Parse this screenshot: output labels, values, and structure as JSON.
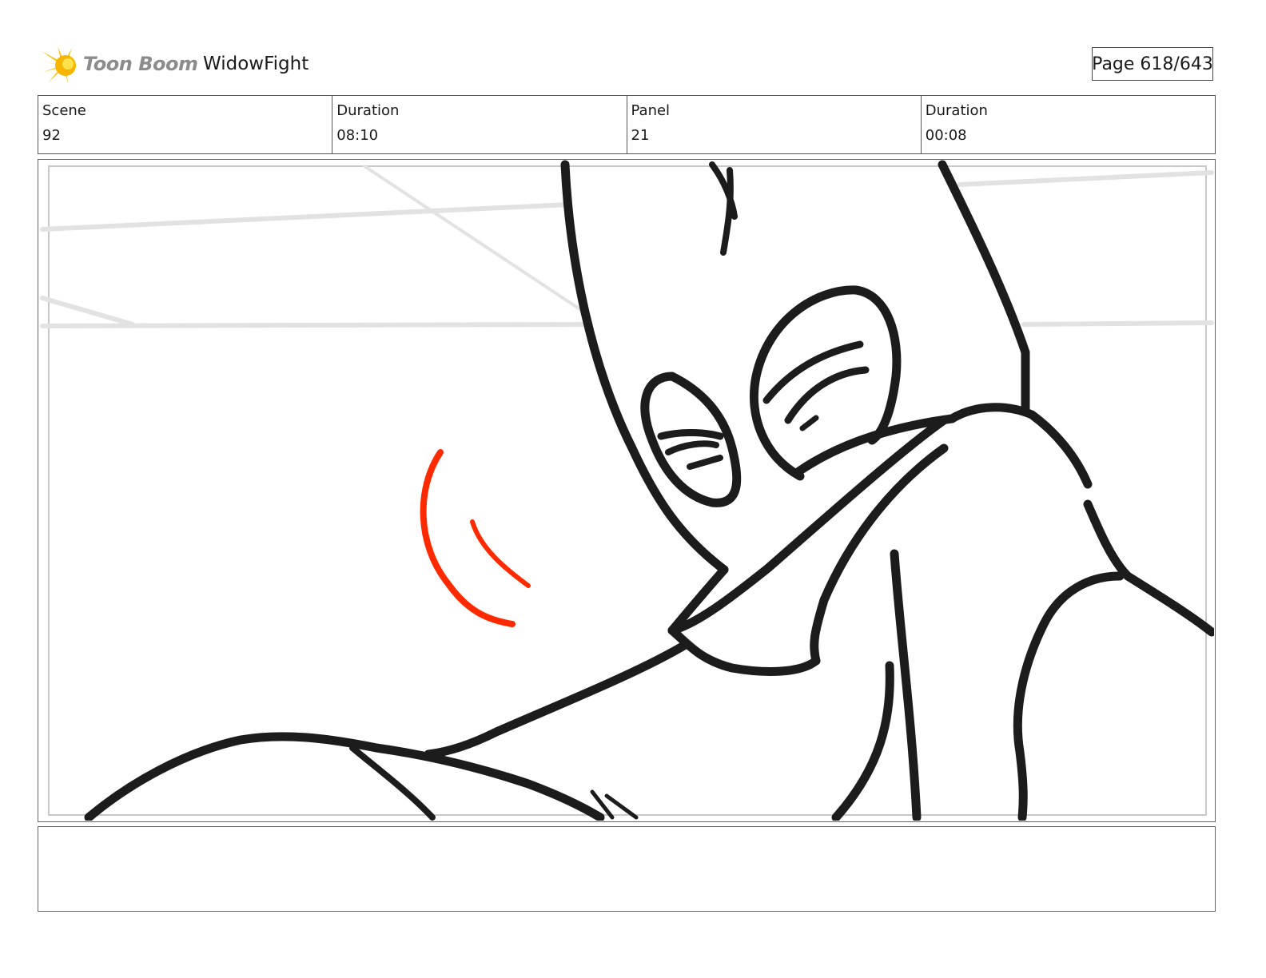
{
  "header": {
    "logo_text": "Toon Boom",
    "project_title": "WidowFight",
    "page_label": "Page 618/643"
  },
  "info": {
    "scene_label": "Scene",
    "scene_value": "92",
    "scene_duration_label": "Duration",
    "scene_duration_value": "08:10",
    "panel_label": "Panel",
    "panel_value": "21",
    "panel_duration_label": "Duration",
    "panel_duration_value": "00:08"
  },
  "notes": {
    "text": ""
  },
  "colors": {
    "line_art": "#1c1c1c",
    "sketch_guides": "#e2e2e2",
    "action_marks": "#ff2a00",
    "logo_yellow": "#f5c400",
    "border": "#555555"
  },
  "icons": {
    "logo": "toon-boom-starburst-icon"
  }
}
